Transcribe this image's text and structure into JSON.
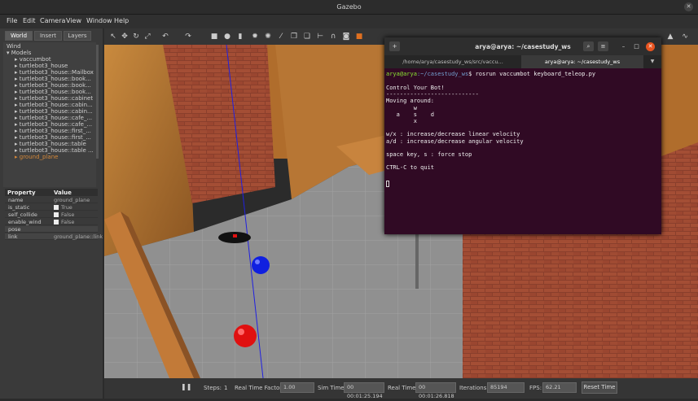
{
  "window": {
    "title": "Gazebo",
    "close_glyph": "✕"
  },
  "menu": [
    "File",
    "Edit",
    "Camera",
    "View",
    "Window",
    "Help"
  ],
  "left_panel": {
    "tabs": [
      "World",
      "Insert",
      "Layers"
    ],
    "tree": [
      {
        "label": "Wind",
        "arrow": ""
      },
      {
        "label": "Models",
        "arrow": "▾"
      },
      {
        "label": "vaccumbot",
        "arrow": "▸"
      },
      {
        "label": "turtlebot3_house",
        "arrow": "▸"
      },
      {
        "label": "turtlebot3_house::Mailbox",
        "arrow": "▸"
      },
      {
        "label": "turtlebot3_house::book...",
        "arrow": "▸"
      },
      {
        "label": "turtlebot3_house::book...",
        "arrow": "▸"
      },
      {
        "label": "turtlebot3_house::book...",
        "arrow": "▸"
      },
      {
        "label": "turtlebot3_house::cabinet",
        "arrow": "▸"
      },
      {
        "label": "turtlebot3_house::cabin...",
        "arrow": "▸"
      },
      {
        "label": "turtlebot3_house::cabin...",
        "arrow": "▸"
      },
      {
        "label": "turtlebot3_house::cafe_...",
        "arrow": "▸"
      },
      {
        "label": "turtlebot3_house::cafe_...",
        "arrow": "▸"
      },
      {
        "label": "turtlebot3_house::first_...",
        "arrow": "▸"
      },
      {
        "label": "turtlebot3_house::first_...",
        "arrow": "▸"
      },
      {
        "label": "turtlebot3_house::table",
        "arrow": "▸"
      },
      {
        "label": "turtlebot3_house::table ...",
        "arrow": "▸"
      },
      {
        "label": "ground_plane",
        "arrow": "▸"
      }
    ],
    "props_header": {
      "property": "Property",
      "value": "Value"
    },
    "props": [
      {
        "key": "name",
        "value": "ground_plane",
        "checkbox": false
      },
      {
        "key": "is_static",
        "value": "True",
        "checkbox": true
      },
      {
        "key": "self_collide",
        "value": "False",
        "checkbox": true
      },
      {
        "key": "enable_wind",
        "value": "False",
        "checkbox": true
      },
      {
        "key": "pose",
        "value": "",
        "checkbox": false
      },
      {
        "key": "link",
        "value": "ground_plane::link",
        "checkbox": false
      }
    ]
  },
  "bottom": {
    "pause_icon": "❚❚",
    "steps_label": "Steps:",
    "steps_value": "1",
    "rtf_label": "Real Time Factor:",
    "rtf_value": "1.00",
    "simtime_label": "Sim Time:",
    "simtime_value": "00 00:01:25.194",
    "realtime_label": "Real Time:",
    "realtime_value": "00 00:01:26.818",
    "iter_label": "Iterations:",
    "iter_value": "85194",
    "fps_label": "FPS:",
    "fps_value": "62.21",
    "reset_label": "Reset Time"
  },
  "terminal": {
    "title": "arya@arya: ~/casestudy_ws",
    "tabs": [
      "/home/arya/casestudy_ws/src/vaccu...",
      "arya@arya: ~/casestudy_ws"
    ],
    "tab_close": "✕",
    "menu_glyph": "≡",
    "search_glyph": "⌕",
    "new_tab_glyph": "+",
    "prompt_user": "arya@arya",
    "prompt_path": ":~/casestudy_ws",
    "prompt_cmd": "$ rosrun vaccumbot keyboard_teleop.py",
    "lines": [
      "Control Your Bot!",
      "---------------------------",
      "Moving around:",
      "        w",
      "   a    s    d",
      "        x",
      "",
      "w/x : increase/decrease linear velocity",
      "a/d : increase/decrease angular velocity",
      "",
      "space key, s : force stop",
      "",
      "CTRL-C to quit"
    ]
  },
  "colors": {
    "terminal_bg": "#300a24",
    "close_button": "#e95420",
    "selected_tree_item": "#d4883a",
    "robot_red": "#e01010",
    "ball_blue": "#1020e0",
    "ball_red": "#e01010"
  }
}
